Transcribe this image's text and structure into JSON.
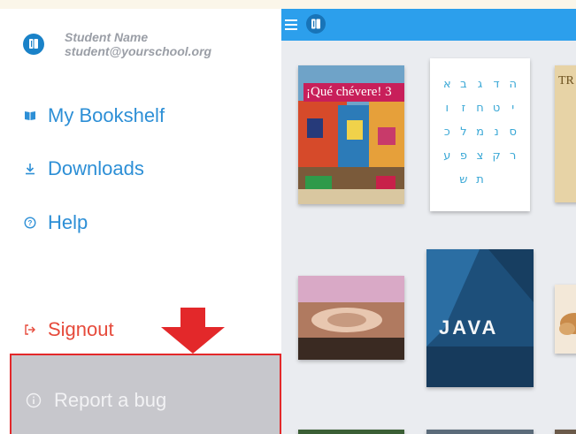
{
  "drawer": {
    "user": {
      "name": "Student Name",
      "email": "student@yourschool.org"
    },
    "items": [
      {
        "label": "My Bookshelf",
        "icon": "book-icon"
      },
      {
        "label": "Downloads",
        "icon": "download-icon"
      },
      {
        "label": "Help",
        "icon": "help-icon"
      },
      {
        "label": "Signout",
        "icon": "signout-icon"
      }
    ],
    "report": {
      "label": "Report a bug",
      "icon": "info-icon"
    }
  },
  "bookshelf": {
    "books": [
      {
        "title": "¡Qué chévere! 3"
      },
      {
        "title": ""
      },
      {
        "title": "TR"
      },
      {
        "title": ""
      },
      {
        "title": "JAVA"
      },
      {
        "title": ""
      }
    ]
  },
  "colors": {
    "accent": "#2c9fec",
    "link": "#2d8fd6",
    "signout": "#e64a3b",
    "highlight_border": "#e3282a",
    "arrow": "#e3282a"
  }
}
